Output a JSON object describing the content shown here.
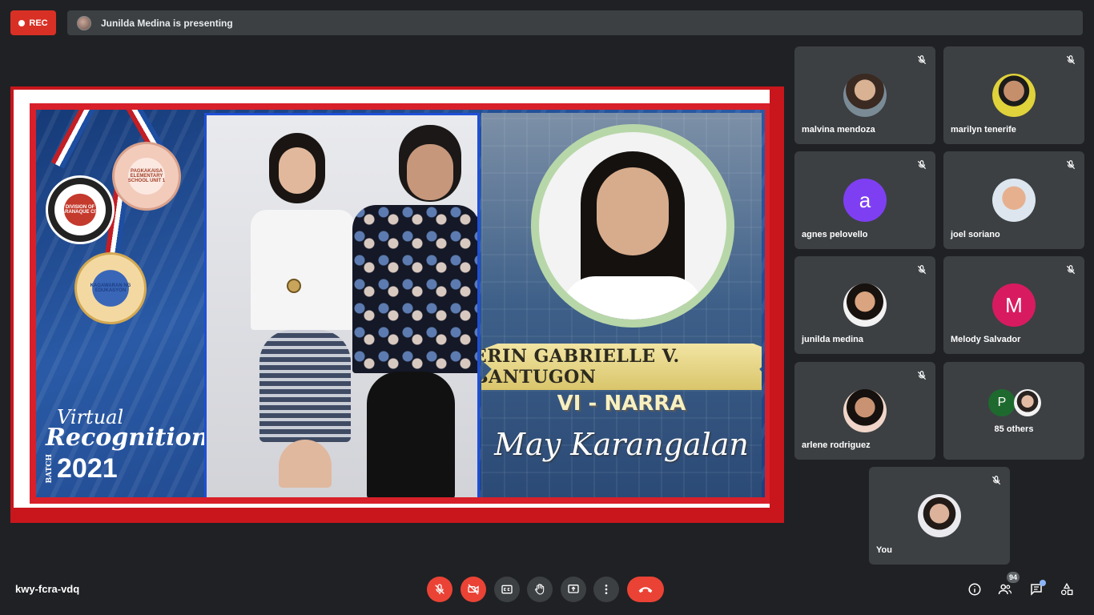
{
  "recording": {
    "label": "REC"
  },
  "presenter_bar": {
    "text": "Junilda Medina is presenting"
  },
  "slide": {
    "school_seal_text": "PAGKAKAISA ELEMENTARY SCHOOL UNIT 1",
    "division_seal_text": "DIVISION OF PARANAQUE CITY",
    "deped_seal_text": "KAGAWARAN NG EDUKASYON",
    "title_line1": "Virtual",
    "title_line2": "Recognition",
    "batch_label": "BATCH",
    "year": "2021",
    "student_name": "ERIN GABRIELLE V. BANTUGON",
    "section": "VI - NARRA",
    "award": "May Karangalan"
  },
  "participants": [
    {
      "name": "malvina mendoza",
      "muted": true
    },
    {
      "name": "marilyn tenerife",
      "muted": true
    },
    {
      "name": "agnes pelovello",
      "initial": "a",
      "color": "#7e3ff2",
      "muted": true
    },
    {
      "name": "joel soriano",
      "muted": true
    },
    {
      "name": "junilda medina",
      "muted": true
    },
    {
      "name": "Melody Salvador",
      "initial": "M",
      "color": "#d81b60",
      "muted": true
    },
    {
      "name": "arlene rodriguez",
      "muted": true
    },
    {
      "name": "85 others",
      "initial": "P",
      "color": "#1e6a2e"
    },
    {
      "name": "You",
      "muted": true
    }
  ],
  "bottom_bar": {
    "meeting_code": "kwy-fcra-vdq",
    "people_count": "94",
    "icons": [
      "mic-off-icon",
      "camera-off-icon",
      "captions-icon",
      "raise-hand-icon",
      "present-icon",
      "more-options-icon",
      "hang-up-icon",
      "info-icon",
      "people-icon",
      "chat-icon",
      "activities-icon"
    ]
  },
  "colors": {
    "background": "#202124",
    "tile": "#3c4043",
    "red": "#ea4335",
    "rec": "#d93025"
  }
}
